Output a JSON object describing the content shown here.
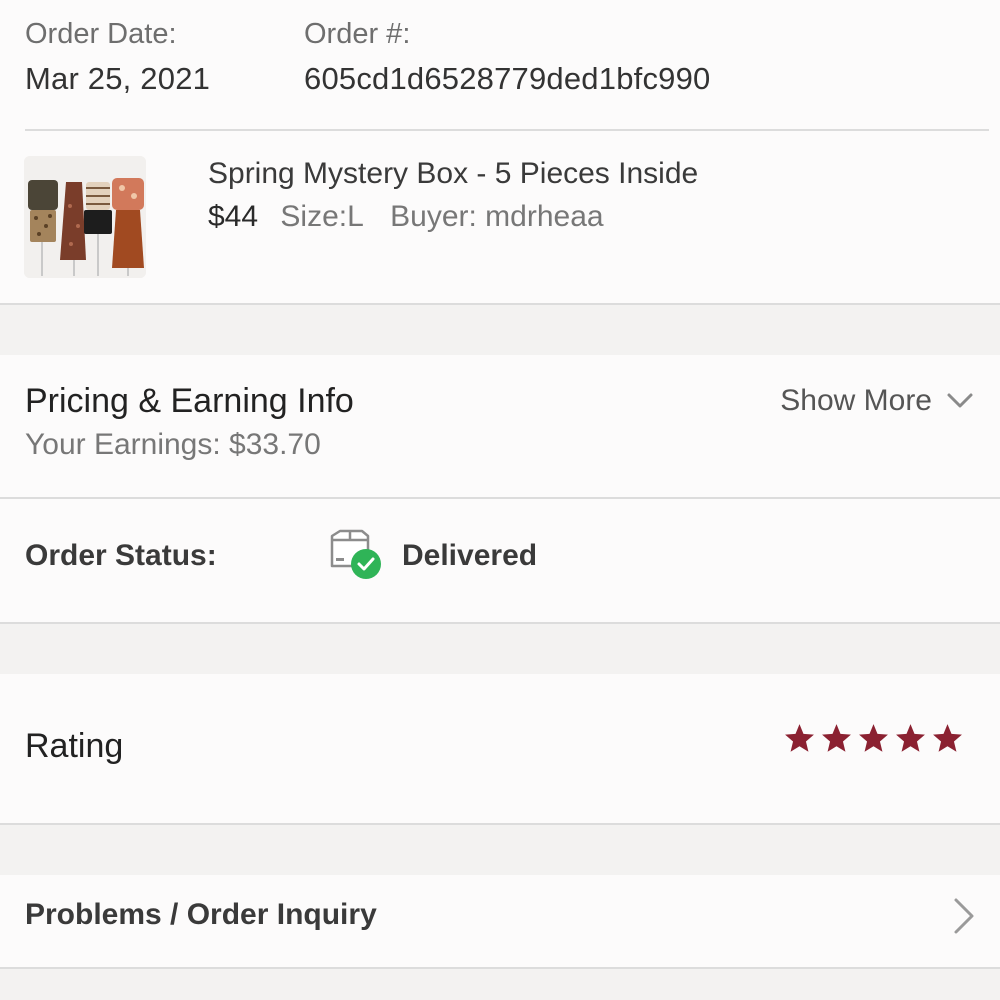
{
  "order": {
    "date_label": "Order Date:",
    "date_value": "Mar 25, 2021",
    "number_label": "Order #:",
    "number_value": "605cd1d6528779ded1bfc990"
  },
  "item": {
    "title": "Spring Mystery Box - 5 Pieces Inside",
    "price": "$44",
    "size": "Size:L",
    "buyer": "Buyer: mdrheaa",
    "thumbnail_icon": "product-photo-clothing-on-mannequins"
  },
  "pricing": {
    "title": "Pricing & Earning Info",
    "earnings": "Your Earnings: $33.70",
    "show_more_label": "Show More",
    "show_more_icon": "chevron-down-icon"
  },
  "status": {
    "label": "Order Status:",
    "value": "Delivered",
    "icon": "package-delivered-icon",
    "check_color": "#2fb457"
  },
  "rating": {
    "label": "Rating",
    "stars_filled": 5,
    "stars_total": 5,
    "star_color": "#8b2131"
  },
  "problems": {
    "label": "Problems / Order Inquiry",
    "icon": "chevron-right-icon"
  }
}
